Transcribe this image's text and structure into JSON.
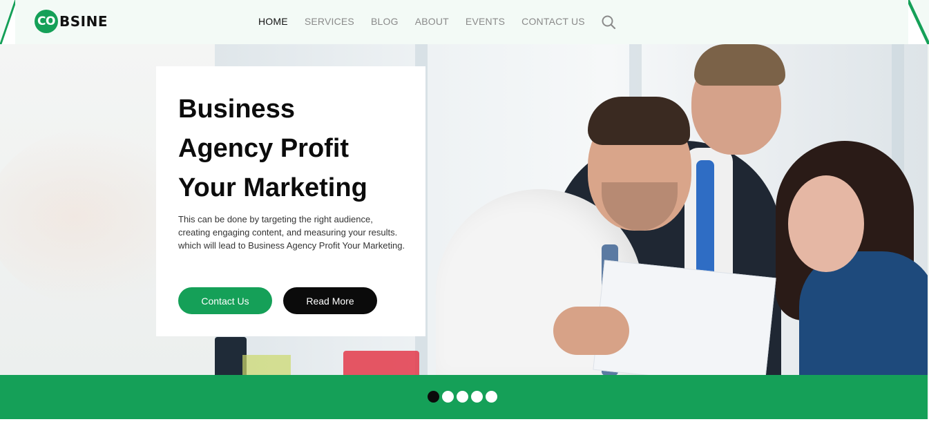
{
  "brand": {
    "logo_mark": "CO",
    "logo_rest": "BSINE",
    "accent_color": "#15a058",
    "dark_color": "#0b0b0b"
  },
  "nav": {
    "items": [
      {
        "label": "HOME",
        "active": true
      },
      {
        "label": "SERVICES",
        "active": false
      },
      {
        "label": "BLOG",
        "active": false
      },
      {
        "label": "ABOUT",
        "active": false
      },
      {
        "label": "EVENTS",
        "active": false
      },
      {
        "label": "CONTACT US",
        "active": false
      }
    ],
    "search_icon": "search-icon"
  },
  "hero": {
    "title_lines": [
      "Business",
      "Agency Profit",
      "Your Marketing"
    ],
    "description": "This can be done by targeting the right audience, creating engaging content, and measuring your results. which will lead to Business Agency Profit Your Marketing.",
    "primary_button": "Contact Us",
    "secondary_button": "Read More"
  },
  "slider": {
    "total": 5,
    "active_index": 0
  }
}
